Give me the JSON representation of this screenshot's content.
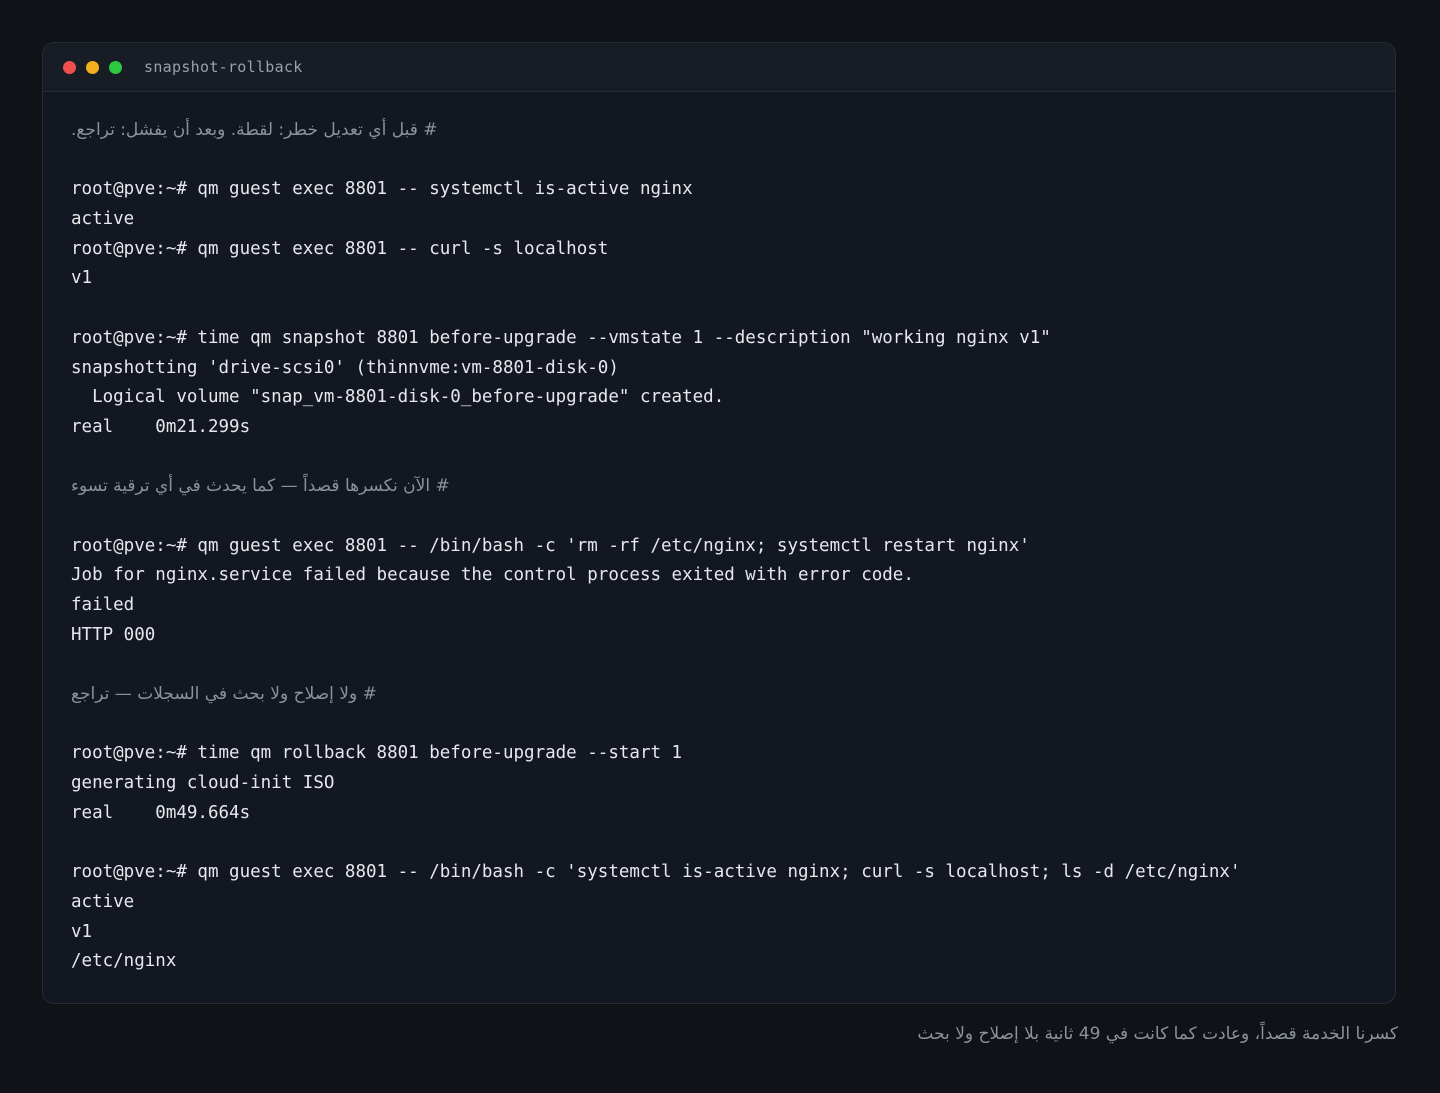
{
  "window": {
    "title": "snapshot-rollback",
    "colors": {
      "close": "#ef4f4f",
      "minimize": "#f2b01e",
      "maximize": "#2cc840"
    }
  },
  "terminal": {
    "lines": [
      {
        "type": "comment",
        "text": "# قبل أي تعديل خطر: لقطة. وبعد أن يفشل: تراجع."
      },
      {
        "type": "blank",
        "text": ""
      },
      {
        "type": "cmd",
        "text": "root@pve:~# qm guest exec 8801 -- systemctl is-active nginx"
      },
      {
        "type": "out",
        "text": "active"
      },
      {
        "type": "cmd",
        "text": "root@pve:~# qm guest exec 8801 -- curl -s localhost"
      },
      {
        "type": "out",
        "text": "v1"
      },
      {
        "type": "blank",
        "text": ""
      },
      {
        "type": "cmd",
        "text": "root@pve:~# time qm snapshot 8801 before-upgrade --vmstate 1 --description \"working nginx v1\""
      },
      {
        "type": "out",
        "text": "snapshotting 'drive-scsi0' (thinnvme:vm-8801-disk-0)"
      },
      {
        "type": "out",
        "text": "  Logical volume \"snap_vm-8801-disk-0_before-upgrade\" created."
      },
      {
        "type": "out",
        "text": "real    0m21.299s"
      },
      {
        "type": "blank",
        "text": ""
      },
      {
        "type": "comment",
        "text": "# الآن نكسرها قصداً — كما يحدث في أي ترقية تسوء"
      },
      {
        "type": "blank",
        "text": ""
      },
      {
        "type": "cmd",
        "text": "root@pve:~# qm guest exec 8801 -- /bin/bash -c 'rm -rf /etc/nginx; systemctl restart nginx'"
      },
      {
        "type": "out",
        "text": "Job for nginx.service failed because the control process exited with error code."
      },
      {
        "type": "out",
        "text": "failed"
      },
      {
        "type": "out",
        "text": "HTTP 000"
      },
      {
        "type": "blank",
        "text": ""
      },
      {
        "type": "comment",
        "text": "# ولا إصلاح ولا بحث في السجلات — تراجع"
      },
      {
        "type": "blank",
        "text": ""
      },
      {
        "type": "cmd",
        "text": "root@pve:~# time qm rollback 8801 before-upgrade --start 1"
      },
      {
        "type": "out",
        "text": "generating cloud-init ISO"
      },
      {
        "type": "out",
        "text": "real    0m49.664s"
      },
      {
        "type": "blank",
        "text": ""
      },
      {
        "type": "cmd",
        "text": "root@pve:~# qm guest exec 8801 -- /bin/bash -c 'systemctl is-active nginx; curl -s localhost; ls -d /etc/nginx'"
      },
      {
        "type": "out",
        "text": "active"
      },
      {
        "type": "out",
        "text": "v1"
      },
      {
        "type": "out",
        "text": "/etc/nginx"
      }
    ]
  },
  "caption": "كسرنا الخدمة قصداً، وعادت كما كانت في 49 ثانية بلا إصلاح ولا بحث"
}
